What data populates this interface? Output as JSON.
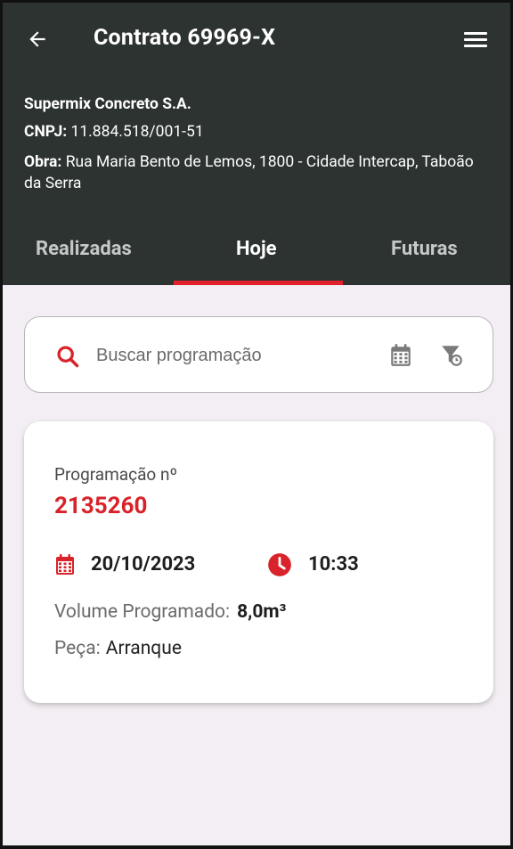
{
  "header": {
    "title": "Contrato 69969-X",
    "company": "Supermix Concreto S.A.",
    "cnpj_label": "CNPJ:",
    "cnpj_value": "11.884.518/001-51",
    "obra_label": "Obra:",
    "obra_value": "Rua Maria Bento de Lemos, 1800 - Cidade Intercap, Taboão da Serra"
  },
  "tabs": [
    {
      "label": "Realizadas",
      "active": false
    },
    {
      "label": "Hoje",
      "active": true
    },
    {
      "label": "Futuras",
      "active": false
    }
  ],
  "search": {
    "placeholder": "Buscar programação"
  },
  "card": {
    "label": "Programação nº",
    "number": "2135260",
    "date": "20/10/2023",
    "time": "10:33",
    "volume_label": "Volume Programado:",
    "volume_value": "8,0m³",
    "peca_label": "Peça:",
    "peca_value": "Arranque"
  },
  "colors": {
    "header_bg": "#2c3331",
    "accent": "#d8232a",
    "background": "#f3eef3"
  },
  "icons": {
    "back": "arrow-left-icon",
    "menu": "hamburger-menu-icon",
    "search": "search-icon",
    "calendar": "calendar-icon",
    "filter": "filter-icon",
    "clock": "clock-icon"
  }
}
